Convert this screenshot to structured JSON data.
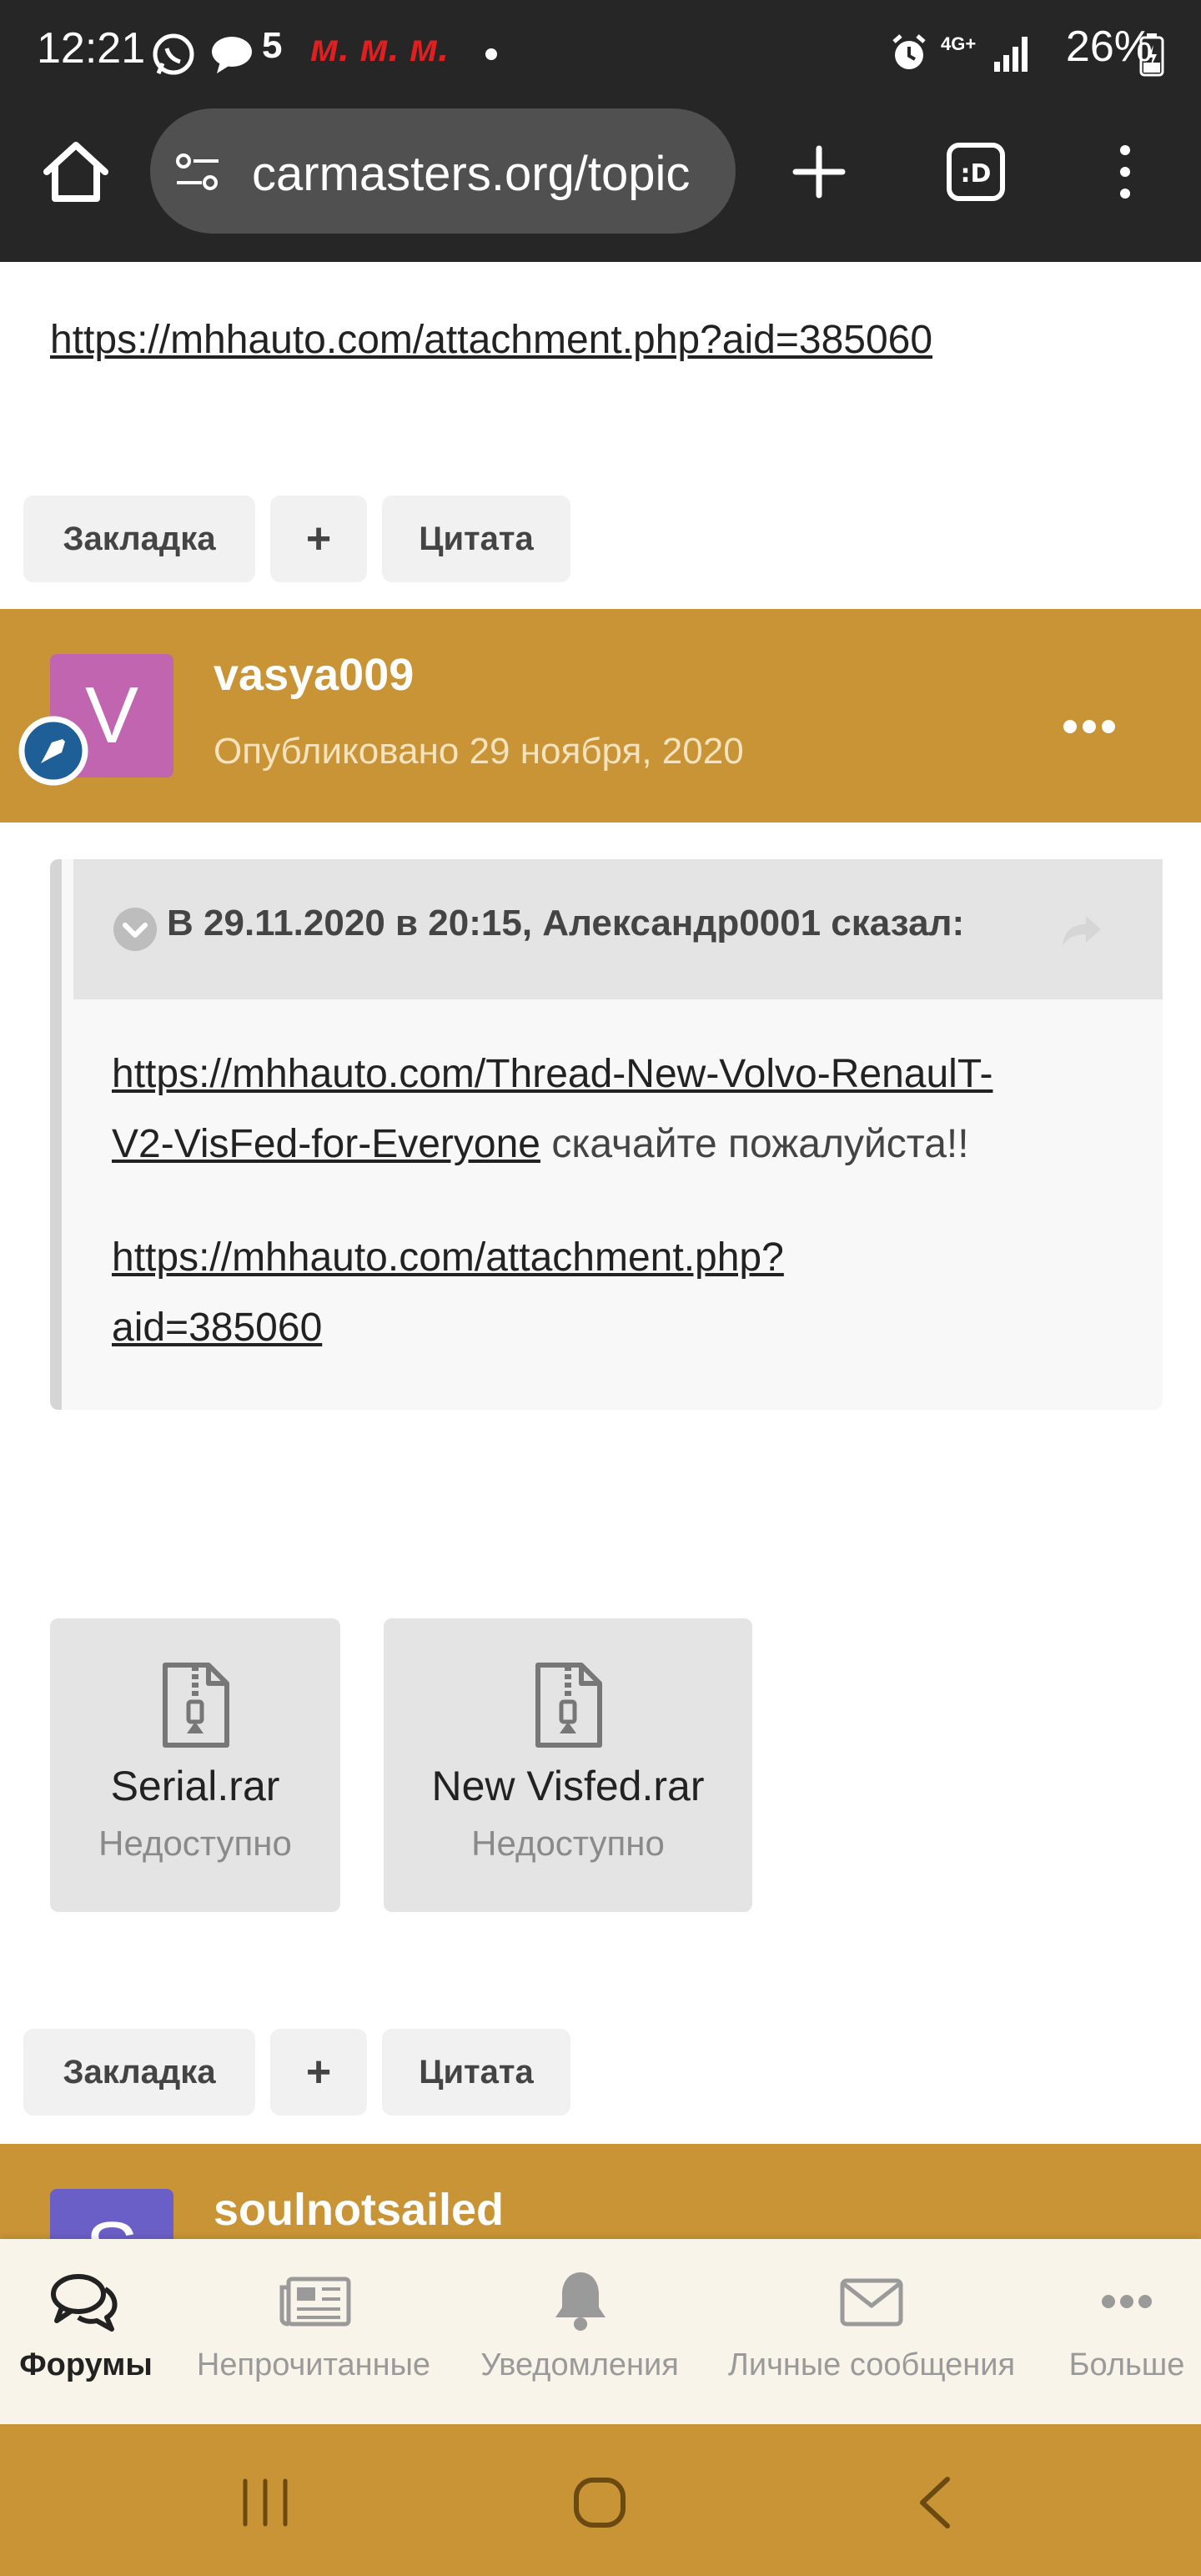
{
  "status_bar": {
    "time": "12:21",
    "notif_text": "м. м. м.",
    "notif_five": "5",
    "network": "4G+",
    "battery": "26%"
  },
  "browser": {
    "url": "carmasters.org/topic"
  },
  "previous_post": {
    "link": "https://mhhauto.com/attachment.php?aid=385060"
  },
  "toolbar": {
    "bookmark": "Закладка",
    "plus": "+",
    "quote": "Цитата"
  },
  "post": {
    "avatar_letter": "V",
    "username": "vasya009",
    "date": "Опубликовано 29 ноября, 2020",
    "quote_header": "В 29.11.2020 в 20:15, Александр0001 сказал:",
    "quote_link1_line1": "https://mhhauto.com/Thread-New-Volvo-RenaulT-",
    "quote_link1_line2": "V2-VisFed-for-Everyone",
    "quote_text_after": " скачайте пожалуйста!!",
    "quote_link2_line1": "https://mhhauto.com/attachment.php?",
    "quote_link2_line2": "aid=385060",
    "attachments": [
      {
        "name": "Serial.rar",
        "status": "Недоступно"
      },
      {
        "name": "New Visfed.rar",
        "status": "Недоступно"
      }
    ]
  },
  "next_post": {
    "avatar_letter": "S",
    "username": "soulnotsailed"
  },
  "bottom_tabs": [
    {
      "label": "Форумы",
      "icon": "chat-bubbles-icon"
    },
    {
      "label": "Непрочитанные",
      "icon": "newspaper-icon"
    },
    {
      "label": "Уведомления",
      "icon": "bell-icon"
    },
    {
      "label": "Личные сообщения",
      "icon": "envelope-icon"
    },
    {
      "label": "Больше",
      "icon": "more-dots-icon"
    }
  ],
  "colors": {
    "accent": "#c89436",
    "avatar_v": "#c165b0",
    "avatar_s": "#6a5fc7",
    "badge": "#1f5f98"
  }
}
